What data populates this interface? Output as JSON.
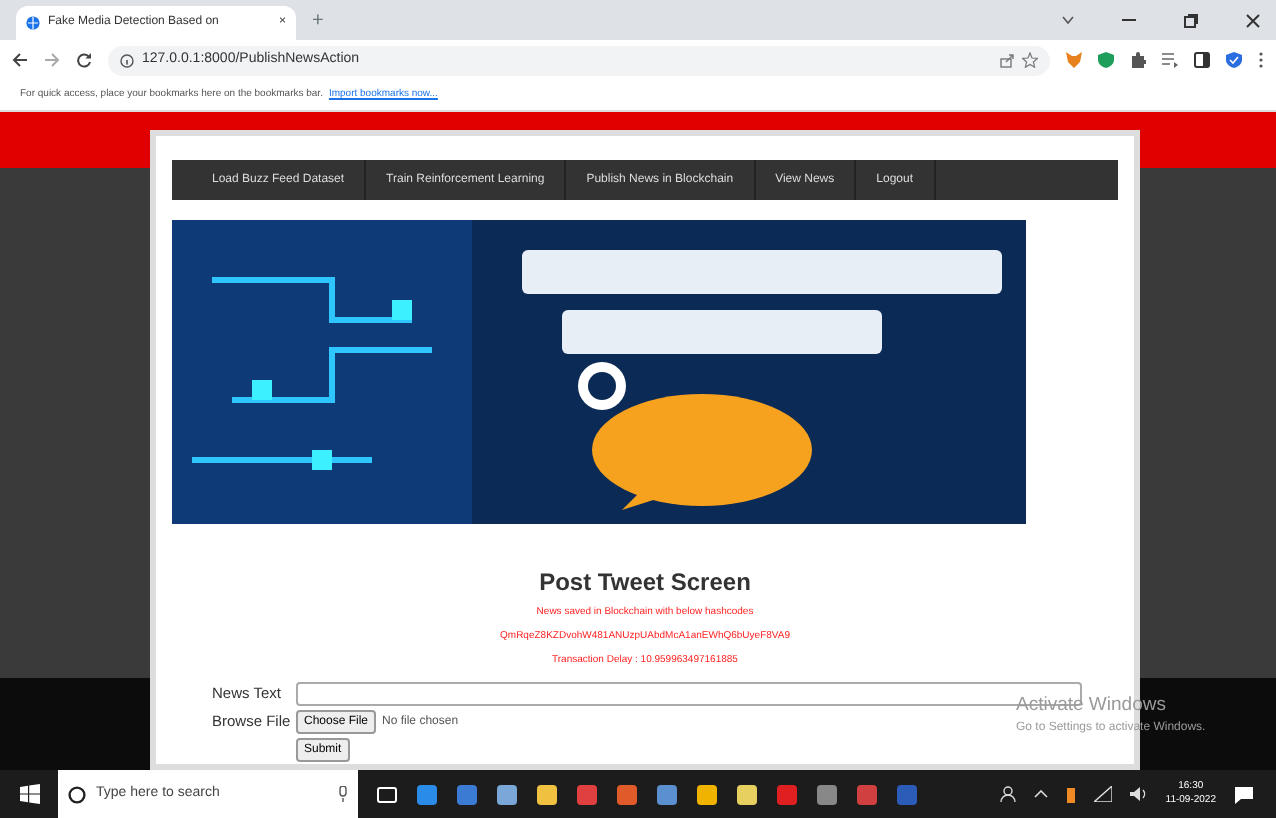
{
  "browser": {
    "tab": {
      "title": "Fake Media Detection Based on",
      "close": "×"
    },
    "new_tab": "+",
    "address": "127.0.0.1:8000/PublishNewsAction",
    "bookmarks_hint": "For quick access, place your bookmarks here on the bookmarks bar.",
    "bookmarks_link": "Import bookmarks now..."
  },
  "nav": [
    {
      "label": "Load Buzz Feed Dataset"
    },
    {
      "label": "Train Reinforcement Learning"
    },
    {
      "label": "Publish News in Blockchain"
    },
    {
      "label": "View News"
    },
    {
      "label": "Logout"
    }
  ],
  "heading": "Post Tweet Screen",
  "messages": [
    "News saved in Blockchain with below hashcodes",
    "QmRqeZ8KZDvohW481ANUzpUAbdMcA1anEWhQ6bUyeF8VA9",
    "Transaction Delay : 10.959963497161885"
  ],
  "form": {
    "news_label": "News Text",
    "file_label": "Browse File",
    "choose_button": "Choose File",
    "file_status": "No file chosen",
    "submit": "Submit"
  },
  "watermark": {
    "title": "Activate Windows",
    "subtitle": "Go to Settings to activate Windows."
  },
  "taskbar": {
    "search_placeholder": "Type here to search",
    "time": "16:30",
    "date": "11-09-2022"
  }
}
